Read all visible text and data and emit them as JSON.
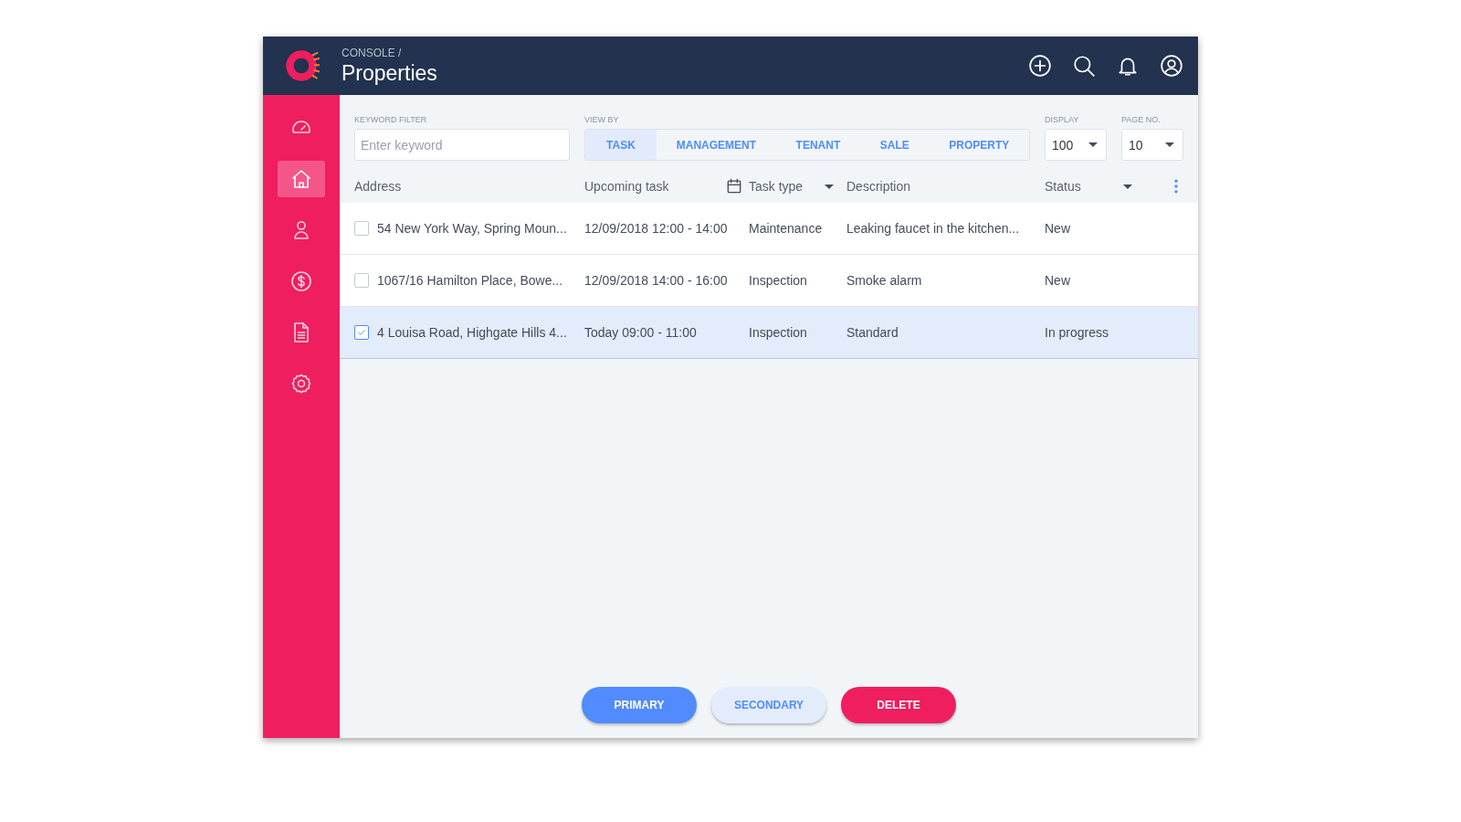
{
  "header": {
    "breadcrumb": "CONSOLE /",
    "title": "Properties",
    "actions": [
      {
        "kind": "add"
      },
      {
        "kind": "search"
      },
      {
        "kind": "bell"
      },
      {
        "kind": "user"
      }
    ]
  },
  "sidebar": {
    "items": [
      {
        "kind": "gauge",
        "selected": false
      },
      {
        "kind": "home",
        "selected": true
      },
      {
        "kind": "person",
        "selected": false
      },
      {
        "kind": "dollar",
        "selected": false
      },
      {
        "kind": "document",
        "selected": false
      },
      {
        "kind": "gear",
        "selected": false
      }
    ]
  },
  "filters": {
    "keyword": {
      "label": "KEYWORD FILTER",
      "placeholder": "Enter keyword"
    },
    "view_by": {
      "label": "VIEW BY",
      "tabs": [
        {
          "label": "TASK",
          "selected": true
        },
        {
          "label": "MANAGEMENT",
          "selected": false
        },
        {
          "label": "TENANT",
          "selected": false
        },
        {
          "label": "SALE",
          "selected": false
        },
        {
          "label": "PROPERTY",
          "selected": false
        }
      ]
    },
    "display": {
      "label": "DISPLAY",
      "value": "100"
    },
    "page_no": {
      "label": "PAGE NO.",
      "value": "10"
    }
  },
  "table": {
    "columns": [
      {
        "label": "Address",
        "kind": "plain"
      },
      {
        "label": "Upcoming task",
        "kind": "date"
      },
      {
        "label": "Task type",
        "kind": "sortable"
      },
      {
        "label": "Description",
        "kind": "plain"
      },
      {
        "label": "Status",
        "kind": "sortable"
      }
    ],
    "rows": [
      {
        "checked": false,
        "cells": [
          "54 New York Way, Spring Moun...",
          "12/09/2018 12:00 - 14:00",
          "Maintenance",
          "Leaking faucet in the kitchen...",
          "New"
        ]
      },
      {
        "checked": false,
        "cells": [
          "1067/16 Hamilton Place, Bowe...",
          "12/09/2018 14:00 - 16:00",
          "Inspection",
          "Smoke alarm",
          "New"
        ]
      },
      {
        "checked": true,
        "cells": [
          "4 Louisa Road, Highgate Hills 4...",
          "Today 09:00 - 11:00",
          "Inspection",
          "Standard",
          "In progress"
        ]
      }
    ]
  },
  "buttons": [
    {
      "label": "PRIMARY",
      "kind": "primary"
    },
    {
      "label": "SECONDARY",
      "kind": "secondary"
    },
    {
      "label": "DELETE",
      "kind": "danger"
    }
  ]
}
